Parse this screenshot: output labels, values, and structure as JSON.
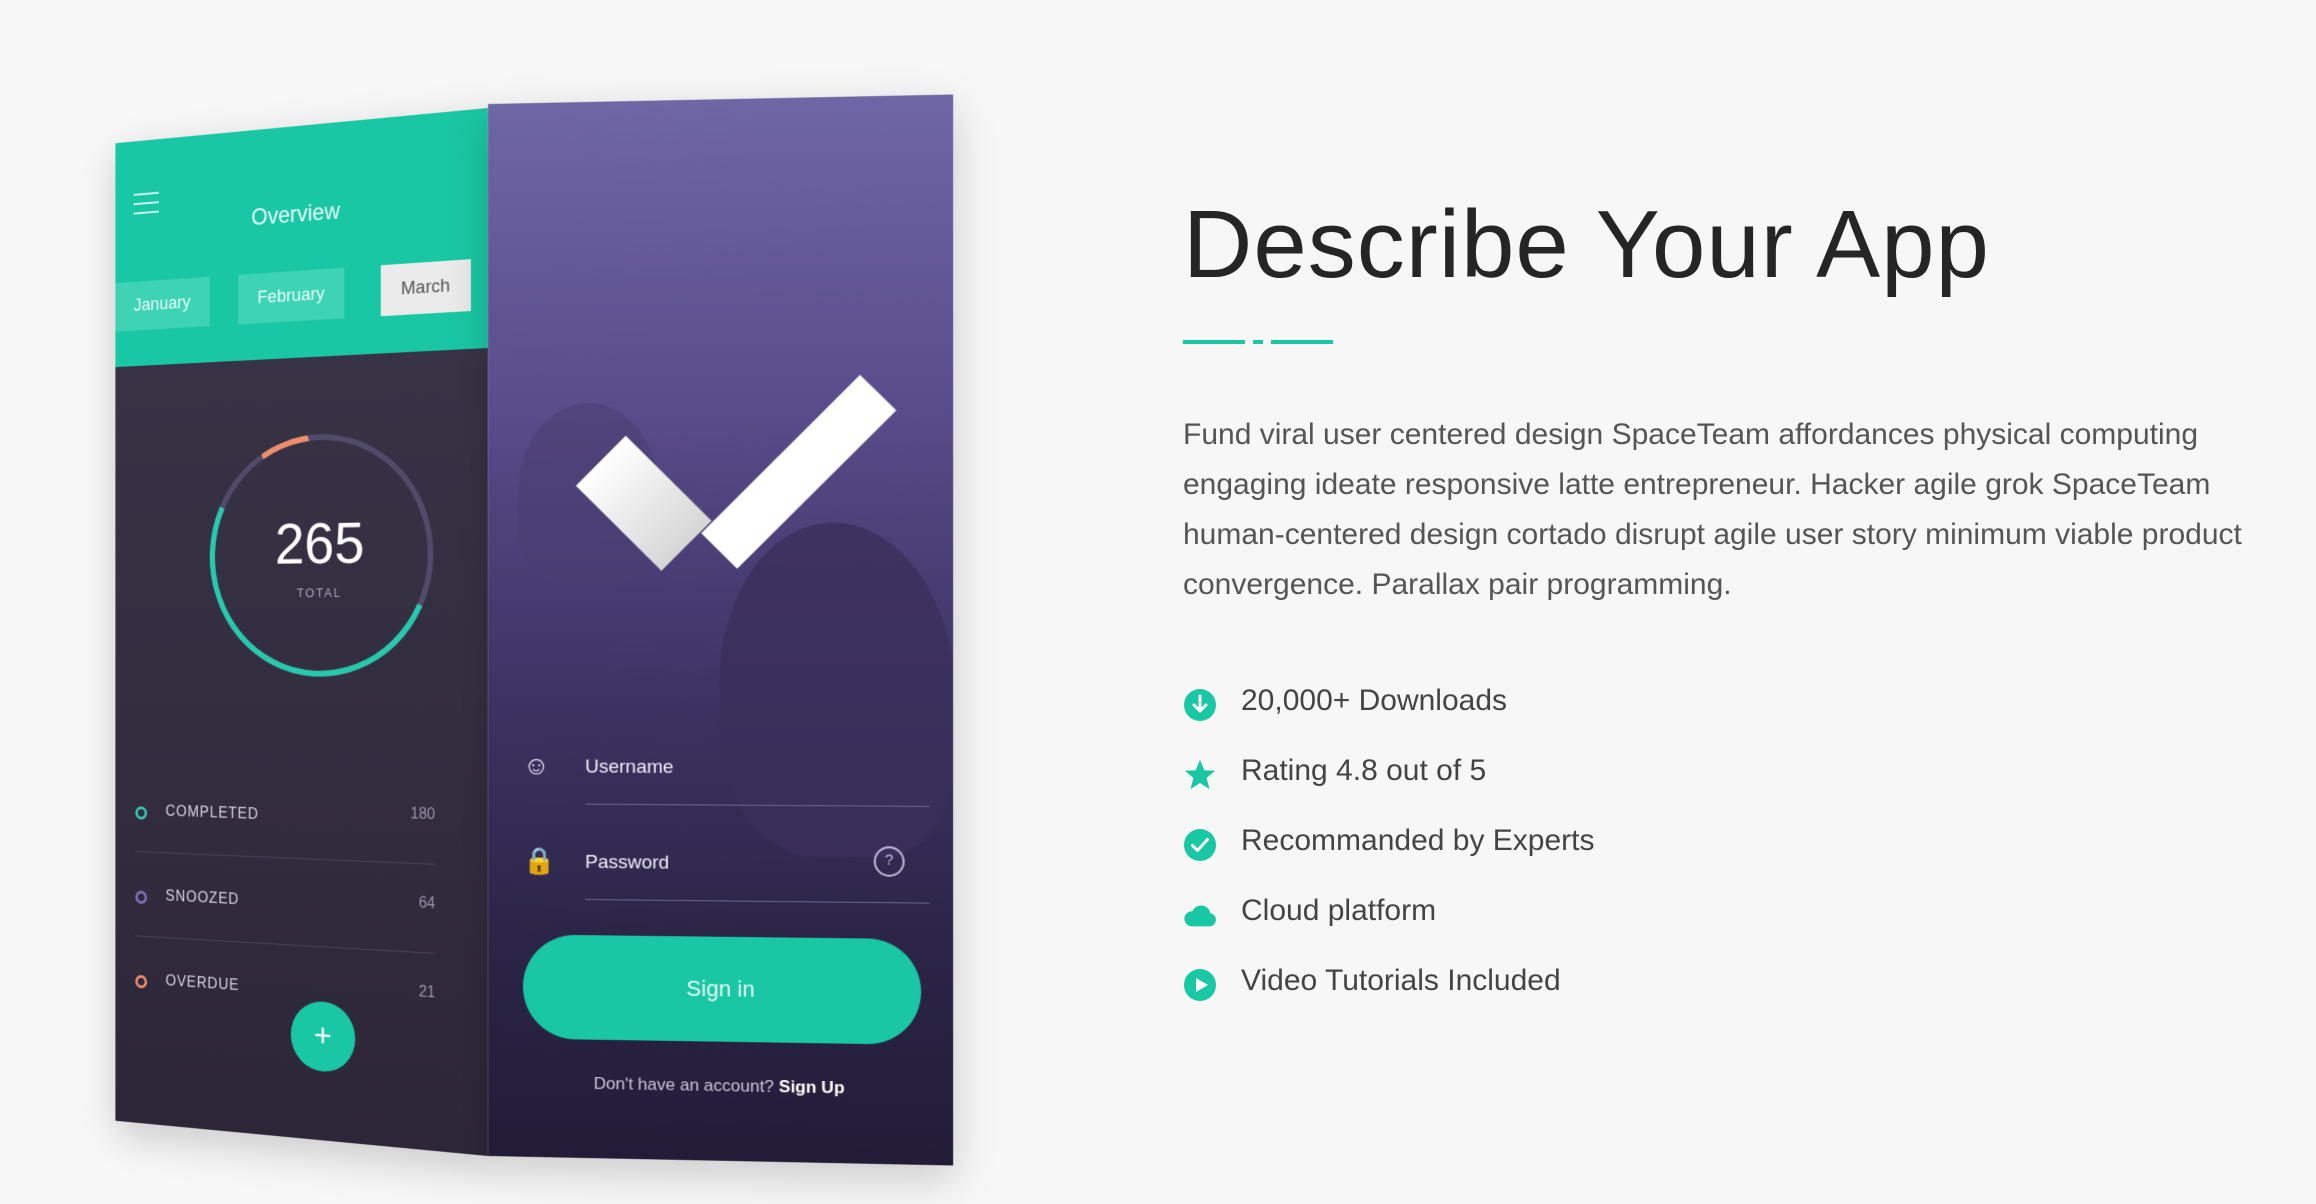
{
  "left_phone": {
    "header_title": "Overview",
    "months": [
      "January",
      "February",
      "March"
    ],
    "active_month": "March",
    "total_value": "265",
    "total_label": "TOTAL",
    "stats": [
      {
        "label": "COMPLETED",
        "value": "180",
        "color": "#35c9b0"
      },
      {
        "label": "SNOOZED",
        "value": "64",
        "color": "#7c6fb5"
      },
      {
        "label": "OVERDUE",
        "value": "21",
        "color": "#ee8e6c"
      }
    ],
    "fab_label": "+"
  },
  "right_phone": {
    "username_placeholder": "Username",
    "password_placeholder": "Password",
    "help_glyph": "?",
    "signin_label": "Sign in",
    "signup_prompt": "Don't have an account?",
    "signup_link": "Sign Up"
  },
  "content": {
    "heading": "Describe Your App",
    "description": "Fund viral user centered design SpaceTeam affordances physical computing engaging ideate responsive latte entrepreneur. Hacker agile grok SpaceTeam human-centered design cortado disrupt agile user story minimum viable product convergence. Parallax pair programming.",
    "features": [
      {
        "icon": "download-icon",
        "label": "20,000+ Downloads"
      },
      {
        "icon": "star-icon",
        "label": "Rating 4.8 out of 5"
      },
      {
        "icon": "check-circle-icon",
        "label": "Recommanded by Experts"
      },
      {
        "icon": "cloud-icon",
        "label": "Cloud platform"
      },
      {
        "icon": "play-icon",
        "label": "Video Tutorials Included"
      }
    ]
  },
  "colors": {
    "accent": "#19c7a4",
    "heading": "#252525",
    "body_text": "#555555",
    "background": "#f7f7f7"
  }
}
